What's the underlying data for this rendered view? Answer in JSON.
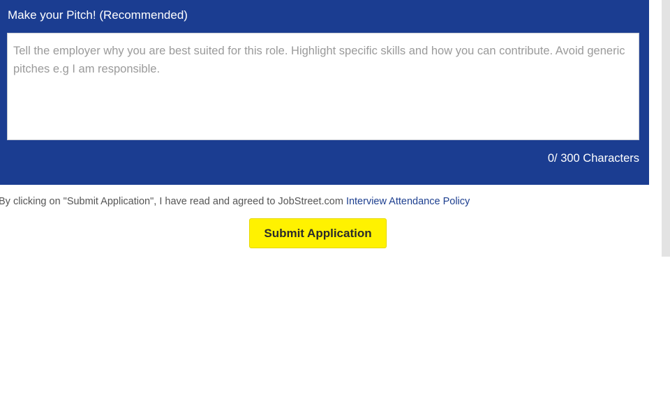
{
  "pitch": {
    "title": "Make your Pitch! (Recommended)",
    "placeholder": "Tell the employer why you are best suited for this role. Highlight specific skills and how you can contribute. Avoid generic pitches e.g I am responsible.",
    "value": "",
    "counter": "0/ 300 Characters"
  },
  "consent": {
    "text": "By clicking on \"Submit Application\", I have read and agreed to JobStreet.com ",
    "link_label": "Interview Attendance Policy"
  },
  "actions": {
    "submit_label": "Submit Application"
  },
  "colors": {
    "panel_bg": "#1b3d91",
    "submit_bg": "#fff200",
    "link": "#1d3f8f"
  }
}
